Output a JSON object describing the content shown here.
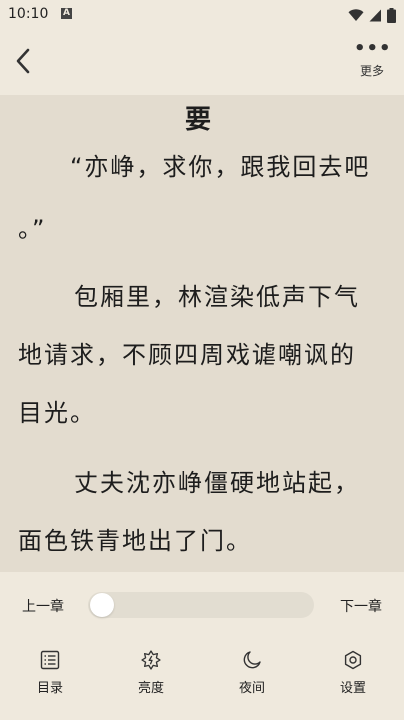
{
  "status": {
    "time": "10:10",
    "notification_glyph": "A"
  },
  "header": {
    "more_label": "更多"
  },
  "reader": {
    "chapter_heading": "要",
    "lines": [
      "“亦峥，求你，跟我回去吧",
      "。”",
      "包厢里，林渲染低声下气",
      "地请求，不顾四周戏谑嘲讽的",
      "目光。",
      "丈夫沈亦峥僵硬地站起，",
      "面色铁青地出了门。"
    ]
  },
  "controls": {
    "prev_chapter": "上一章",
    "next_chapter": "下一章",
    "progress": 0
  },
  "menu": [
    {
      "label": "目录",
      "icon": "list-icon"
    },
    {
      "label": "亮度",
      "icon": "brightness-icon"
    },
    {
      "label": "夜间",
      "icon": "moon-icon"
    },
    {
      "label": "设置",
      "icon": "settings-icon"
    }
  ],
  "colors": {
    "page_bg": "#e3dccf",
    "bar_bg": "#efe9dd",
    "text": "#1d1d1d"
  }
}
